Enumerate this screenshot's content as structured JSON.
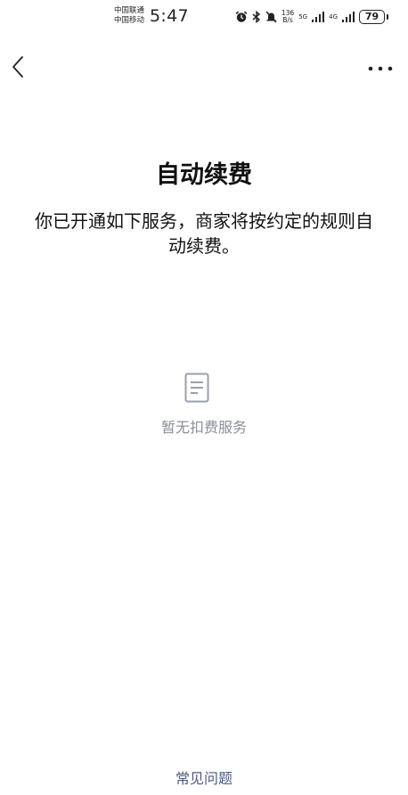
{
  "status_bar": {
    "carrier_1": "中国联通",
    "carrier_2": "中国移动",
    "time": "5:47",
    "net_speed_value": "136",
    "net_speed_unit": "B/s",
    "network_1": "5G",
    "network_2": "4G",
    "battery": "79"
  },
  "header": {
    "back_icon": "chevron-left-icon",
    "more_icon": "more-horizontal-icon"
  },
  "main": {
    "title": "自动续费",
    "description": "你已开通如下服务，商家将按约定的规则自动续费。",
    "empty_icon": "document-icon",
    "empty_text": "暂无扣费服务"
  },
  "footer": {
    "faq_link": "常见问题"
  },
  "colors": {
    "text_primary": "#111111",
    "text_muted": "#8a8f99",
    "link": "#4b5a86",
    "background": "#ffffff"
  }
}
